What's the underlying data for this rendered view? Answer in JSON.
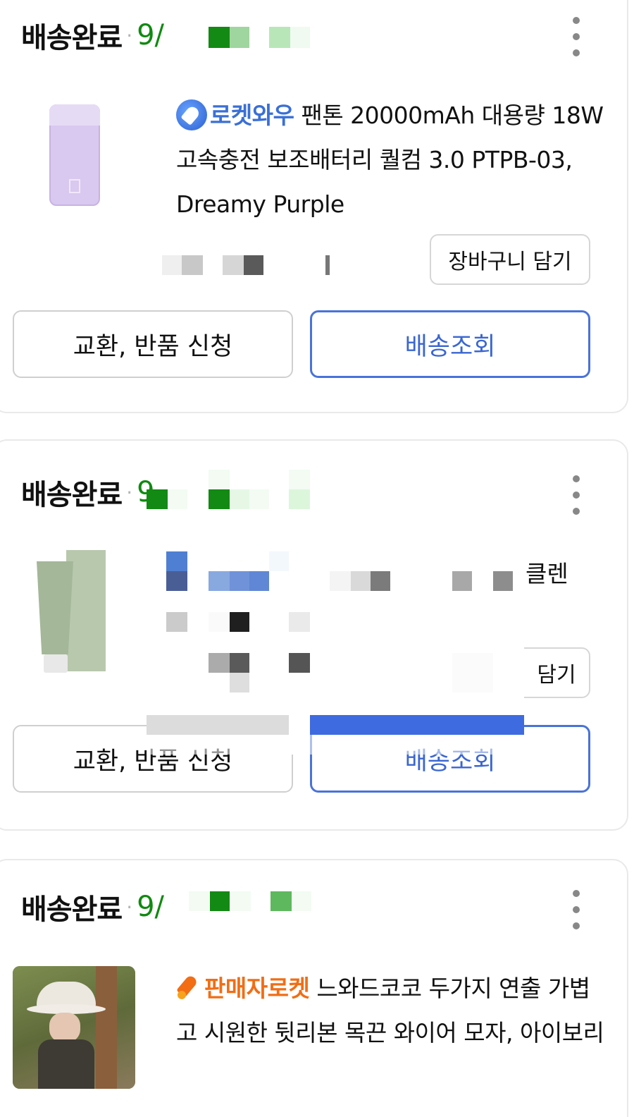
{
  "orders": [
    {
      "status": "배송완료",
      "date_partial": "9/",
      "badge": "로켓와우",
      "title": "팬톤 20000mAh 대용량 18W 고속충전 보조배터리 퀄컴 3.0 PTPB-03, Dreamy Purple",
      "cart_button": "장바구니 담기",
      "exchange_button": "교환, 반품 신청",
      "track_button": "배송조회"
    },
    {
      "status": "배송완료",
      "date_partial": "9",
      "title_fragment": "클렌",
      "cart_button_fragment": "담기",
      "exchange_button": "교환, 반품 신청",
      "track_button": "배송조회"
    },
    {
      "status": "배송완료",
      "date_partial": "9/",
      "badge": "판매자로켓",
      "title": "느와드코코 두가지 연출 가볍고 시원한 뒷리본 목끈 와이어 모자, 아이보리"
    }
  ],
  "colors": {
    "date_green": "#108a10",
    "rocket_blue": "#3a6fd6",
    "seller_orange": "#f26d14",
    "track_border": "#4a73d9"
  },
  "icons": [
    "more-vertical-icon",
    "rocket-wow-icon",
    "seller-rocket-icon"
  ]
}
